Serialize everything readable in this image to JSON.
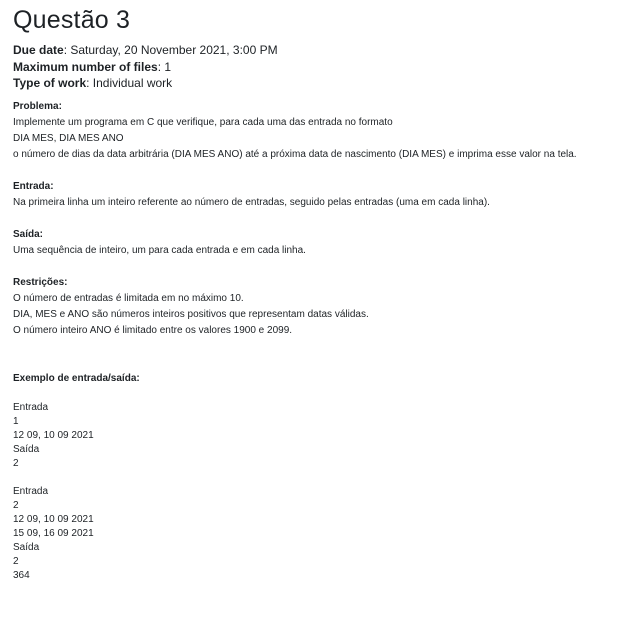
{
  "title": "Questão 3",
  "meta": {
    "due_date_label": "Due date",
    "due_date_value": ": Saturday, 20 November 2021, 3:00 PM",
    "max_files_label": "Maximum number of files",
    "max_files_value": ": 1",
    "work_type_label": "Type of work",
    "work_type_value": ": Individual work"
  },
  "problema": {
    "heading": "Problema:",
    "lines": [
      "Implemente um programa em C que verifique, para cada uma das entrada no formato",
      "DIA MES, DIA MES ANO",
      "o número de dias da data arbitrária (DIA MES ANO) até a próxima data de nascimento (DIA MES) e imprima esse valor na tela."
    ]
  },
  "entrada": {
    "heading": "Entrada:",
    "lines": [
      "Na primeira linha um inteiro referente ao número de entradas, seguido pelas entradas (uma em cada linha)."
    ]
  },
  "saida": {
    "heading": "Saída:",
    "lines": [
      "Uma sequência de inteiro, um para cada entrada e em cada linha."
    ]
  },
  "restricoes": {
    "heading": "Restrições:",
    "lines": [
      "O número de entradas é limitada em no máximo 10.",
      "DIA, MES e ANO são números inteiros positivos que representam datas válidas.",
      "O número inteiro ANO é limitado entre os valores 1900 e 2099."
    ]
  },
  "exemplo": {
    "heading": "Exemplo de entrada/saída:",
    "example1": [
      "Entrada",
      "1",
      "12 09, 10 09 2021",
      "Saída",
      "2"
    ],
    "example2": [
      "Entrada",
      "2",
      "12 09, 10 09 2021",
      "15 09, 16 09 2021",
      "Saída",
      "2",
      "364"
    ]
  }
}
